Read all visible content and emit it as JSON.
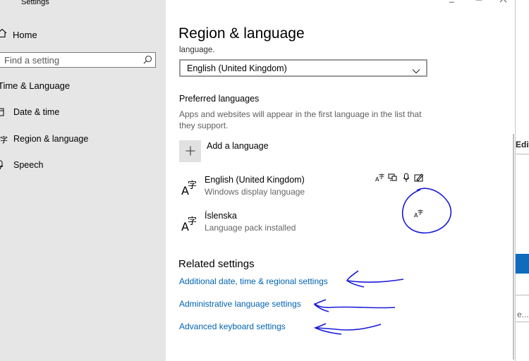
{
  "window": {
    "title": "Settings"
  },
  "sidebar": {
    "home_label": "Home",
    "search_placeholder": "Find a setting",
    "section_header": "Time & Language",
    "items": [
      {
        "label": "Date & time",
        "icon": "calendar-clock-icon"
      },
      {
        "label": "Region & language",
        "icon": "language-icon"
      },
      {
        "label": "Speech",
        "icon": "microphone-icon"
      }
    ]
  },
  "main": {
    "title": "Region & language",
    "cut_text": "language.",
    "display_language": {
      "selected": "English (United Kingdom)"
    },
    "preferred": {
      "heading": "Preferred languages",
      "description": "Apps and websites will appear in the first language in the list that they support.",
      "add_label": "Add a language",
      "languages": [
        {
          "name": "English (United Kingdom)",
          "status": "Windows display language"
        },
        {
          "name": "Íslenska",
          "status": "Language pack installed"
        }
      ]
    },
    "related": {
      "heading": "Related settings",
      "links": [
        "Additional date, time & regional settings",
        "Administrative language settings",
        "Advanced keyboard settings"
      ]
    }
  },
  "background_window": {
    "text_fragment": "Edit",
    "text_fragment_2": "e..."
  },
  "colors": {
    "accent": "#0063b1",
    "sidebar_bg": "#e6e6e6",
    "annotation_ink": "#1a1adb"
  }
}
